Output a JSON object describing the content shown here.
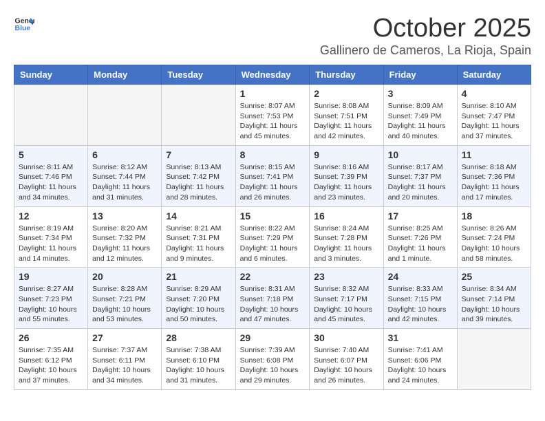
{
  "header": {
    "logo_general": "General",
    "logo_blue": "Blue",
    "month": "October 2025",
    "location": "Gallinero de Cameros, La Rioja, Spain"
  },
  "days_of_week": [
    "Sunday",
    "Monday",
    "Tuesday",
    "Wednesday",
    "Thursday",
    "Friday",
    "Saturday"
  ],
  "weeks": [
    [
      {
        "day": "",
        "sunrise": "",
        "sunset": "",
        "daylight": "",
        "empty": true
      },
      {
        "day": "",
        "sunrise": "",
        "sunset": "",
        "daylight": "",
        "empty": true
      },
      {
        "day": "",
        "sunrise": "",
        "sunset": "",
        "daylight": "",
        "empty": true
      },
      {
        "day": "1",
        "sunrise": "Sunrise: 8:07 AM",
        "sunset": "Sunset: 7:53 PM",
        "daylight": "Daylight: 11 hours and 45 minutes."
      },
      {
        "day": "2",
        "sunrise": "Sunrise: 8:08 AM",
        "sunset": "Sunset: 7:51 PM",
        "daylight": "Daylight: 11 hours and 42 minutes."
      },
      {
        "day": "3",
        "sunrise": "Sunrise: 8:09 AM",
        "sunset": "Sunset: 7:49 PM",
        "daylight": "Daylight: 11 hours and 40 minutes."
      },
      {
        "day": "4",
        "sunrise": "Sunrise: 8:10 AM",
        "sunset": "Sunset: 7:47 PM",
        "daylight": "Daylight: 11 hours and 37 minutes."
      }
    ],
    [
      {
        "day": "5",
        "sunrise": "Sunrise: 8:11 AM",
        "sunset": "Sunset: 7:46 PM",
        "daylight": "Daylight: 11 hours and 34 minutes."
      },
      {
        "day": "6",
        "sunrise": "Sunrise: 8:12 AM",
        "sunset": "Sunset: 7:44 PM",
        "daylight": "Daylight: 11 hours and 31 minutes."
      },
      {
        "day": "7",
        "sunrise": "Sunrise: 8:13 AM",
        "sunset": "Sunset: 7:42 PM",
        "daylight": "Daylight: 11 hours and 28 minutes."
      },
      {
        "day": "8",
        "sunrise": "Sunrise: 8:15 AM",
        "sunset": "Sunset: 7:41 PM",
        "daylight": "Daylight: 11 hours and 26 minutes."
      },
      {
        "day": "9",
        "sunrise": "Sunrise: 8:16 AM",
        "sunset": "Sunset: 7:39 PM",
        "daylight": "Daylight: 11 hours and 23 minutes."
      },
      {
        "day": "10",
        "sunrise": "Sunrise: 8:17 AM",
        "sunset": "Sunset: 7:37 PM",
        "daylight": "Daylight: 11 hours and 20 minutes."
      },
      {
        "day": "11",
        "sunrise": "Sunrise: 8:18 AM",
        "sunset": "Sunset: 7:36 PM",
        "daylight": "Daylight: 11 hours and 17 minutes."
      }
    ],
    [
      {
        "day": "12",
        "sunrise": "Sunrise: 8:19 AM",
        "sunset": "Sunset: 7:34 PM",
        "daylight": "Daylight: 11 hours and 14 minutes."
      },
      {
        "day": "13",
        "sunrise": "Sunrise: 8:20 AM",
        "sunset": "Sunset: 7:32 PM",
        "daylight": "Daylight: 11 hours and 12 minutes."
      },
      {
        "day": "14",
        "sunrise": "Sunrise: 8:21 AM",
        "sunset": "Sunset: 7:31 PM",
        "daylight": "Daylight: 11 hours and 9 minutes."
      },
      {
        "day": "15",
        "sunrise": "Sunrise: 8:22 AM",
        "sunset": "Sunset: 7:29 PM",
        "daylight": "Daylight: 11 hours and 6 minutes."
      },
      {
        "day": "16",
        "sunrise": "Sunrise: 8:24 AM",
        "sunset": "Sunset: 7:28 PM",
        "daylight": "Daylight: 11 hours and 3 minutes."
      },
      {
        "day": "17",
        "sunrise": "Sunrise: 8:25 AM",
        "sunset": "Sunset: 7:26 PM",
        "daylight": "Daylight: 11 hours and 1 minute."
      },
      {
        "day": "18",
        "sunrise": "Sunrise: 8:26 AM",
        "sunset": "Sunset: 7:24 PM",
        "daylight": "Daylight: 10 hours and 58 minutes."
      }
    ],
    [
      {
        "day": "19",
        "sunrise": "Sunrise: 8:27 AM",
        "sunset": "Sunset: 7:23 PM",
        "daylight": "Daylight: 10 hours and 55 minutes."
      },
      {
        "day": "20",
        "sunrise": "Sunrise: 8:28 AM",
        "sunset": "Sunset: 7:21 PM",
        "daylight": "Daylight: 10 hours and 53 minutes."
      },
      {
        "day": "21",
        "sunrise": "Sunrise: 8:29 AM",
        "sunset": "Sunset: 7:20 PM",
        "daylight": "Daylight: 10 hours and 50 minutes."
      },
      {
        "day": "22",
        "sunrise": "Sunrise: 8:31 AM",
        "sunset": "Sunset: 7:18 PM",
        "daylight": "Daylight: 10 hours and 47 minutes."
      },
      {
        "day": "23",
        "sunrise": "Sunrise: 8:32 AM",
        "sunset": "Sunset: 7:17 PM",
        "daylight": "Daylight: 10 hours and 45 minutes."
      },
      {
        "day": "24",
        "sunrise": "Sunrise: 8:33 AM",
        "sunset": "Sunset: 7:15 PM",
        "daylight": "Daylight: 10 hours and 42 minutes."
      },
      {
        "day": "25",
        "sunrise": "Sunrise: 8:34 AM",
        "sunset": "Sunset: 7:14 PM",
        "daylight": "Daylight: 10 hours and 39 minutes."
      }
    ],
    [
      {
        "day": "26",
        "sunrise": "Sunrise: 7:35 AM",
        "sunset": "Sunset: 6:12 PM",
        "daylight": "Daylight: 10 hours and 37 minutes."
      },
      {
        "day": "27",
        "sunrise": "Sunrise: 7:37 AM",
        "sunset": "Sunset: 6:11 PM",
        "daylight": "Daylight: 10 hours and 34 minutes."
      },
      {
        "day": "28",
        "sunrise": "Sunrise: 7:38 AM",
        "sunset": "Sunset: 6:10 PM",
        "daylight": "Daylight: 10 hours and 31 minutes."
      },
      {
        "day": "29",
        "sunrise": "Sunrise: 7:39 AM",
        "sunset": "Sunset: 6:08 PM",
        "daylight": "Daylight: 10 hours and 29 minutes."
      },
      {
        "day": "30",
        "sunrise": "Sunrise: 7:40 AM",
        "sunset": "Sunset: 6:07 PM",
        "daylight": "Daylight: 10 hours and 26 minutes."
      },
      {
        "day": "31",
        "sunrise": "Sunrise: 7:41 AM",
        "sunset": "Sunset: 6:06 PM",
        "daylight": "Daylight: 10 hours and 24 minutes."
      },
      {
        "day": "",
        "sunrise": "",
        "sunset": "",
        "daylight": "",
        "empty": true
      }
    ]
  ]
}
